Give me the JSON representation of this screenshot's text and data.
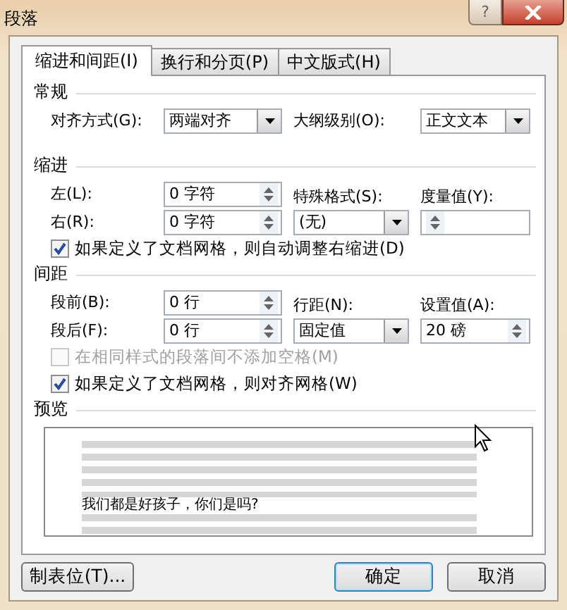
{
  "window": {
    "title": "段落",
    "help": "?"
  },
  "tabs": [
    {
      "label": "缩进和间距(I)",
      "selected": true
    },
    {
      "label": "换行和分页(P)",
      "selected": false
    },
    {
      "label": "中文版式(H)",
      "selected": false
    }
  ],
  "general": {
    "title": "常规",
    "alignment": {
      "label": "对齐方式(G):",
      "value": "两端对齐"
    },
    "outline_level": {
      "label": "大纲级别(O):",
      "value": "正文文本"
    }
  },
  "indent": {
    "title": "缩进",
    "left": {
      "label": "左(L):",
      "value": "0 字符"
    },
    "right": {
      "label": "右(R):",
      "value": "0 字符"
    },
    "special": {
      "label": "特殊格式(S):",
      "value": "(无)"
    },
    "by": {
      "label": "度量值(Y):"
    },
    "checkbox": {
      "label": "如果定义了文档网格，则自动调整右缩进(D)",
      "checked": true,
      "disabled": false
    }
  },
  "spacing": {
    "title": "间距",
    "before": {
      "label": "段前(B):",
      "value": "0 行"
    },
    "after": {
      "label": "段后(F):",
      "value": "0 行"
    },
    "line_spacing": {
      "label": "行距(N):",
      "value": "固定值"
    },
    "at": {
      "label": "设置值(A):",
      "value": "20 磅"
    },
    "checkboxes": [
      {
        "label": "在相同样式的段落间不添加空格(M)",
        "checked": false,
        "disabled": true
      },
      {
        "label": "如果定义了文档网格，则对齐网格(W)",
        "checked": true,
        "disabled": false
      }
    ]
  },
  "preview": {
    "title": "预览",
    "sample_text": "我们都是好孩子，你们是吗?"
  },
  "buttons": [
    {
      "label": "制表位(T)...",
      "default": false
    },
    {
      "label": "确定",
      "default": true
    },
    {
      "label": "取消",
      "default": false
    }
  ]
}
